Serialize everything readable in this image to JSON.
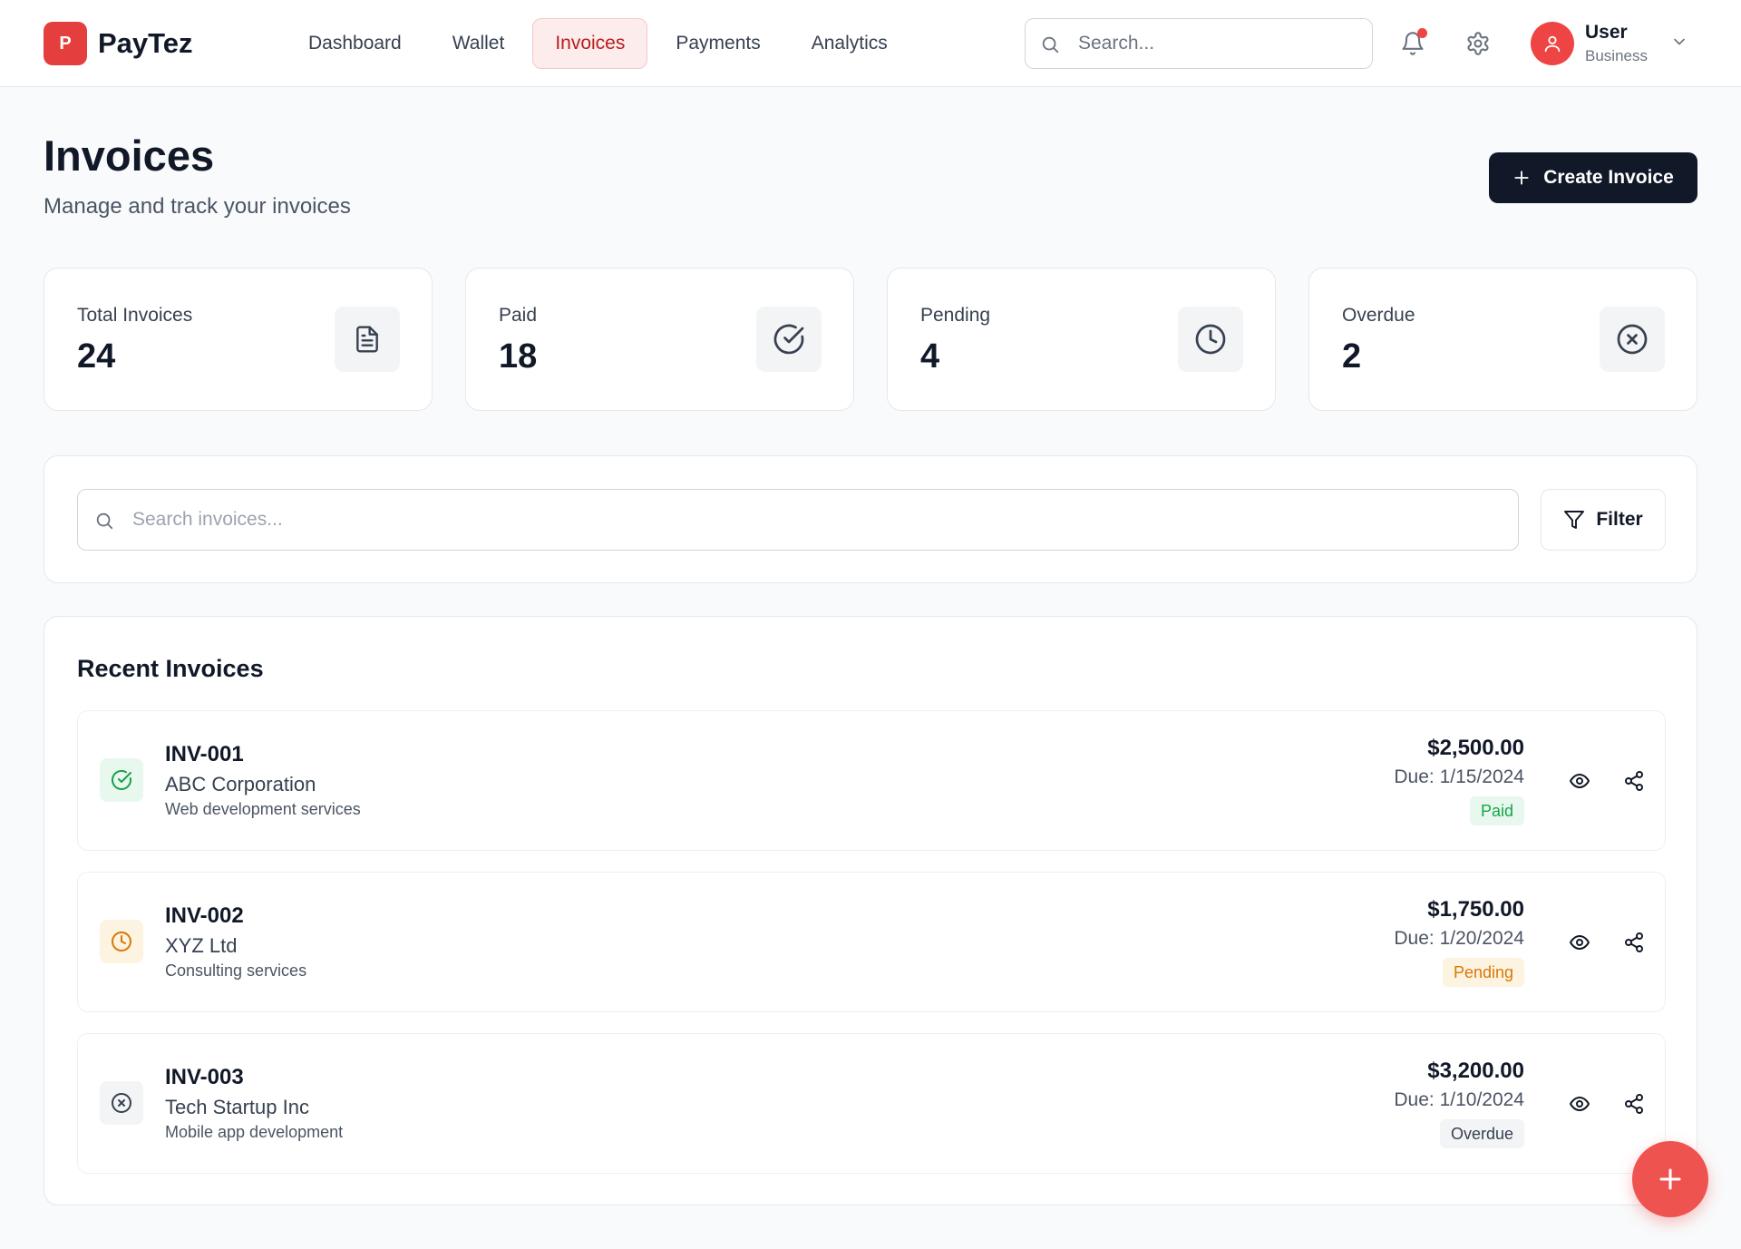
{
  "app": {
    "logo_letter": "P",
    "name": "PayTez"
  },
  "nav": [
    {
      "label": "Dashboard",
      "active": false
    },
    {
      "label": "Wallet",
      "active": false
    },
    {
      "label": "Invoices",
      "active": true
    },
    {
      "label": "Payments",
      "active": false
    },
    {
      "label": "Analytics",
      "active": false
    }
  ],
  "header": {
    "search_placeholder": "Search...",
    "notification_icon": "bell-icon",
    "settings_icon": "gear-icon",
    "user": {
      "name": "User",
      "role": "Business"
    }
  },
  "page": {
    "title": "Invoices",
    "subtitle": "Manage and track your invoices",
    "create_label": "Create Invoice"
  },
  "stats": [
    {
      "label": "Total Invoices",
      "value": "24",
      "icon": "document-icon"
    },
    {
      "label": "Paid",
      "value": "18",
      "icon": "check-circle-icon"
    },
    {
      "label": "Pending",
      "value": "4",
      "icon": "clock-icon"
    },
    {
      "label": "Overdue",
      "value": "2",
      "icon": "x-circle-icon"
    }
  ],
  "filters": {
    "search_placeholder": "Search invoices...",
    "filter_label": "Filter"
  },
  "recent": {
    "title": "Recent Invoices",
    "invoices": [
      {
        "id": "INV-001",
        "client": "ABC Corporation",
        "description": "Web development services",
        "amount": "$2,500.00",
        "due": "Due: 1/15/2024",
        "status": "Paid",
        "status_color": "#16a34a",
        "status_bg": "#e8f8ee"
      },
      {
        "id": "INV-002",
        "client": "XYZ Ltd",
        "description": "Consulting services",
        "amount": "$1,750.00",
        "due": "Due: 1/20/2024",
        "status": "Pending",
        "status_color": "#d97706",
        "status_bg": "#fdf3e1"
      },
      {
        "id": "INV-003",
        "client": "Tech Startup Inc",
        "description": "Mobile app development",
        "amount": "$3,200.00",
        "due": "Due: 1/10/2024",
        "status": "Overdue",
        "status_color": "#374151",
        "status_bg": "#f3f4f6"
      }
    ]
  },
  "colors": {
    "brand": "#e53e3e",
    "dark": "#111827",
    "fab": "#ef5350"
  }
}
